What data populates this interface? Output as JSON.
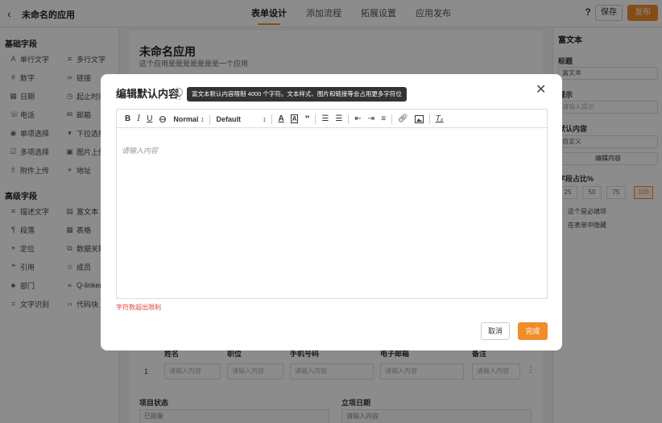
{
  "header": {
    "app_title": "未命名的应用",
    "tabs": [
      {
        "label": "表单设计",
        "active": true
      },
      {
        "label": "添加流程",
        "active": false
      },
      {
        "label": "拓展设置",
        "active": false
      },
      {
        "label": "应用发布",
        "active": false
      }
    ],
    "help_label": "?",
    "save_label": "保存",
    "publish_label": "发布"
  },
  "sidebar": {
    "basic_title": "基础字段",
    "basic_fields": [
      {
        "label": "单行文字",
        "icon": "text-icon"
      },
      {
        "label": "多行文字",
        "icon": "multiline-icon"
      },
      {
        "label": "数字",
        "icon": "number-icon"
      },
      {
        "label": "链接",
        "icon": "link-icon"
      },
      {
        "label": "日期",
        "icon": "date-icon"
      },
      {
        "label": "起止时间",
        "icon": "daterange-icon"
      },
      {
        "label": "电话",
        "icon": "phone-icon"
      },
      {
        "label": "邮箱",
        "icon": "mail-icon"
      },
      {
        "label": "单项选择",
        "icon": "radio-icon"
      },
      {
        "label": "下拉选择",
        "icon": "dropdown-icon"
      },
      {
        "label": "多项选择",
        "icon": "checkbox-icon"
      },
      {
        "label": "图片上传",
        "icon": "image-icon"
      },
      {
        "label": "附件上传",
        "icon": "upload-icon"
      },
      {
        "label": "地址",
        "icon": "location-icon"
      }
    ],
    "advanced_title": "高级字段",
    "advanced_fields": [
      {
        "label": "描述文字",
        "icon": "desc-icon"
      },
      {
        "label": "富文本",
        "icon": "richtext-icon"
      },
      {
        "label": "段落",
        "icon": "paragraph-icon"
      },
      {
        "label": "表格",
        "icon": "table-icon"
      },
      {
        "label": "定位",
        "icon": "position-icon"
      },
      {
        "label": "数据关联",
        "icon": "relation-icon"
      },
      {
        "label": "引用",
        "icon": "quote-icon"
      },
      {
        "label": "成员",
        "icon": "member-icon"
      },
      {
        "label": "部门",
        "icon": "dept-icon"
      },
      {
        "label": "Q-linker",
        "icon": "qlinker-icon"
      },
      {
        "label": "文字识别",
        "icon": "ocr-icon"
      },
      {
        "label": "代码块",
        "icon": "code-icon"
      }
    ]
  },
  "canvas": {
    "title": "未命名应用",
    "subtitle": "这个应用是是是是是是是一个应用",
    "table_headers": [
      "姓名",
      "职位",
      "手机号码",
      "电子邮箱",
      "备注"
    ],
    "row_number": "1",
    "cell_placeholder": "请输入内容",
    "more_label": "⋮",
    "project_status_label": "项目状态",
    "project_status_value": "已报备",
    "project_date_label": "立项日期",
    "project_date_placeholder": "请输入内容"
  },
  "right_panel": {
    "header": "富文本",
    "title_label": "标题",
    "title_value": "富文本",
    "hint_label": "提示",
    "hint_placeholder": "请输入提示",
    "default_label": "默认内容",
    "default_value": "自定义",
    "edit_button": "编辑内容",
    "width_label": "字段占比%",
    "width_options": [
      "25",
      "50",
      "75",
      "100"
    ],
    "width_selected": "100",
    "required_label": "这个是必填项",
    "hide_label": "在表单中隐藏"
  },
  "modal": {
    "title": "编辑默认内容",
    "tooltip": "富文本默认内容限制 4000 个字符。文本样式、图片和链接等会占用更多字符位",
    "close_label": "✕",
    "toolbar": {
      "bold": "B",
      "italic": "I",
      "underline": "U",
      "strike": "S",
      "size": "Normal",
      "font": "Default"
    },
    "editor_placeholder": "请输入内容",
    "error_text": "字符数超出限制",
    "cancel_label": "取消",
    "done_label": "完成"
  },
  "colors": {
    "accent": "#f28c28",
    "error": "#e54545"
  }
}
